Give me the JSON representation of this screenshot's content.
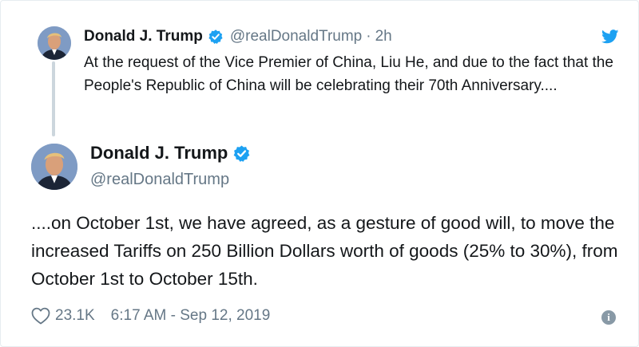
{
  "parent_tweet": {
    "author_name": "Donald J. Trump",
    "handle": "@realDonaldTrump",
    "separator": "·",
    "time_ago": "2h",
    "text": "At the request of the Vice Premier of China, Liu He, and due to the fact that the People's Republic of China will be celebrating their 70th Anniversary...."
  },
  "main_tweet": {
    "author_name": "Donald J. Trump",
    "handle": "@realDonaldTrump",
    "text": "....on October 1st, we have agreed, as a gesture of good will, to move the increased Tariffs on 250 Billion Dollars worth of goods (25% to 30%), from October 1st to October 15th.",
    "like_count": "23.1K",
    "timestamp": "6:17 AM - Sep 12, 2019"
  },
  "icons": {
    "verified": "verified-badge-icon",
    "brand": "twitter-bird-icon",
    "like": "heart-icon",
    "info": "info-icon"
  },
  "colors": {
    "verified_blue": "#1da1f2",
    "brand_blue": "#1da1f2",
    "muted_text": "#657786",
    "thread_line": "#ccd6dd"
  }
}
